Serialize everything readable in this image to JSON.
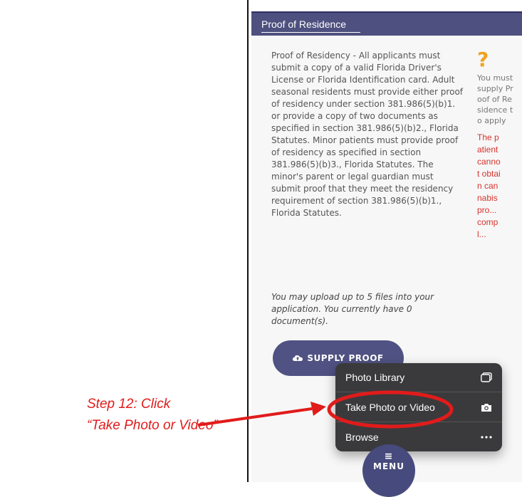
{
  "panel": {
    "title": "Proof of Residence"
  },
  "content": {
    "description": "Proof of Residency - All applicants must submit a copy of a valid Florida Driver's License or Florida Identification card. Adult seasonal residents must provide either proof of residency under section 381.986(5)(b)1. or provide a copy of two documents as specified in section 381.986(5)(b)2., Florida Statutes. Minor patients must provide proof of residency as specified in section 381.986(5)(b)3., Florida Statutes. The minor's parent or legal guardian must submit proof that they meet the residency requirement of section 381.986(5)(b)1., Florida Statutes.",
    "upload_note": "You may upload up to 5 files into your application. You currently have 0 document(s).",
    "supply_button_label": "SUPPLY PROOF"
  },
  "side": {
    "help_glyph": "?",
    "status_text": "You must supply Proof of Residence to apply",
    "warning_text": "The patient cannot obtain cannabis pro... compl..."
  },
  "popup_menu": {
    "items": [
      {
        "label": "Photo Library",
        "icon": "photo-library-icon"
      },
      {
        "label": "Take Photo or Video",
        "icon": "camera-icon"
      },
      {
        "label": "Browse",
        "icon": "more-icon"
      }
    ]
  },
  "bottom_nav": {
    "menu_label": "MENU"
  },
  "annotation": {
    "line1": "Step 12: Click",
    "line2": "“Take Photo or Video”",
    "color": "#e11b1b"
  },
  "colors": {
    "header": "#4e507f",
    "button": "#505283",
    "popup": "#3a3a3c",
    "warning": "#d7332c",
    "help": "#f0a21e"
  }
}
